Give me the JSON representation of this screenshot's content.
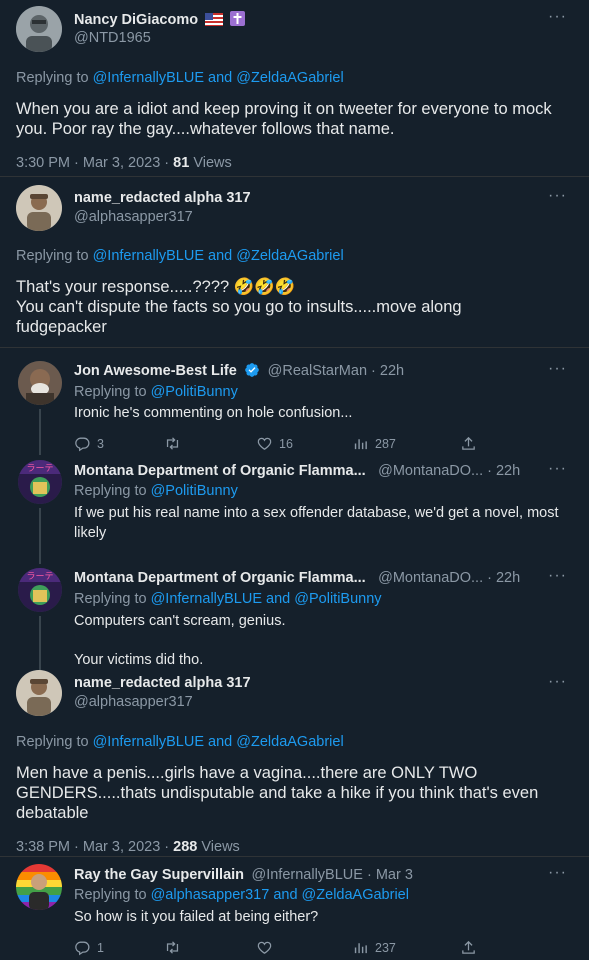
{
  "ui": {
    "more": "···"
  },
  "t1": {
    "name": "Nancy DiGiacomo",
    "handle": "@NTD1965",
    "replying_prefix": "Replying to",
    "replying_to": "@InfernallyBLUE and @ZeldaAGabriel",
    "text": "When you are a idiot and keep proving it on tweeter for everyone to mock you.  Poor ray the gay....whatever follows that name.",
    "time": "3:30 PM · Mar 3, 2023 · ",
    "views_count": "81",
    "views_label": " Views"
  },
  "t2": {
    "name": "name_redacted alpha 317",
    "handle": "@alphasapper317",
    "replying_prefix": "Replying to",
    "replying_to": "@InfernallyBLUE and @ZeldaAGabriel",
    "line1": "That's your response.....???? 🤣🤣🤣",
    "line2": "You can't dispute the facts so you go to insults.....move along fudgepacker"
  },
  "t3": {
    "name": "Jon Awesome-Best Life",
    "handle": "@RealStarMan · 22h",
    "replying_prefix": "Replying to",
    "replying_to": "@PolitiBunny",
    "text": "Ironic he's commenting on hole confusion...",
    "replies": "3",
    "retweets": "",
    "likes": "16",
    "views": "287"
  },
  "t4": {
    "name": "Montana Department of Organic Flamma...",
    "handle": "@MontanaDO... · 22h",
    "replying_prefix": "Replying to",
    "replying_to": "@PolitiBunny",
    "text": "If we put his real name into a sex offender database, we'd get a novel, most likely"
  },
  "t5": {
    "name": "Montana Department of Organic Flamma...",
    "handle": "@MontanaDO... · 22h",
    "replying_prefix": "Replying to",
    "replying_to": "@InfernallyBLUE and @PolitiBunny",
    "line1": "Computers can't scream, genius.",
    "line2": "Your victims did tho."
  },
  "t6": {
    "name": "name_redacted alpha 317",
    "handle": "@alphasapper317",
    "replying_prefix": "Replying to",
    "replying_to": "@InfernallyBLUE and @ZeldaAGabriel",
    "text": "Men have a penis....girls have a vagina....there are ONLY TWO GENDERS.....thats undisputable and take a hike if you think that's even debatable",
    "time": "3:38 PM · Mar 3, 2023 · ",
    "views_count": "288",
    "views_label": " Views"
  },
  "t7": {
    "name": "Ray the Gay Supervillain",
    "handle": "@InfernallyBLUE · Mar 3",
    "replying_prefix": "Replying to",
    "replying_to": "@alphasapper317 and @ZeldaAGabriel",
    "text": "So how is it you failed at being either?",
    "replies": "1",
    "retweets": "",
    "likes": "",
    "views": "237"
  },
  "colors": {
    "background": "#15202b",
    "text": "#e7e9ea",
    "muted": "#8b98a5",
    "link": "#1d9bf0",
    "verified": "#1d9bf0"
  }
}
